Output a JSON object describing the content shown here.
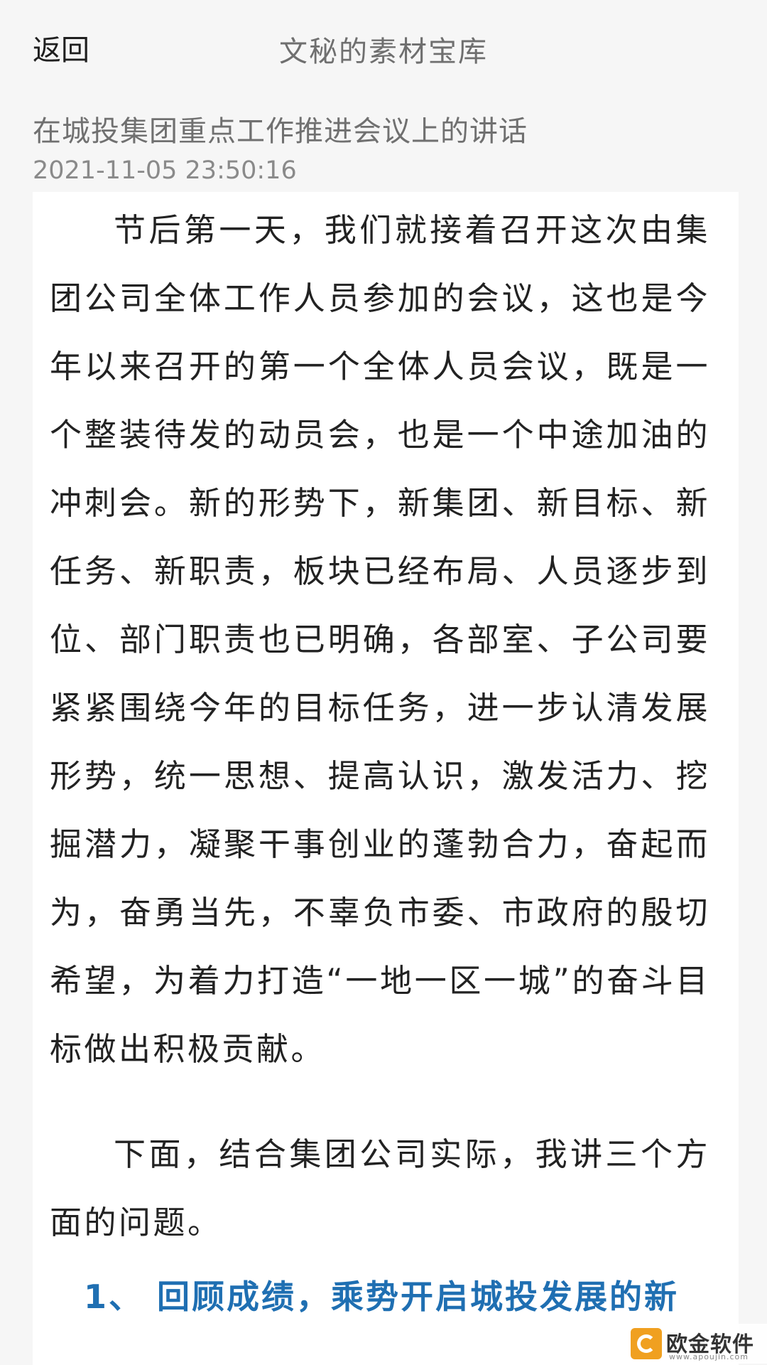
{
  "header": {
    "back_label": "返回",
    "app_title": "文秘的素材宝库"
  },
  "article": {
    "title": "在城投集团重点工作推进会议上的讲话",
    "date": "2021-11-05 23:50:16",
    "paragraphs": [
      "节后第一天，我们就接着召开这次由集团公司全体工作人员参加的会议，这也是今年以来召开的第一个全体人员会议，既是一个整装待发的动员会，也是一个中途加油的冲刺会。新的形势下，新集团、新目标、新任务、新职责，板块已经布局、人员逐步到位、部门职责也已明确，各部室、子公司要紧紧围绕今年的目标任务，进一步认清发展形势，统一思想、提高认识，激发活力、挖掘潜力，凝聚干事创业的蓬勃合力，奋起而为，奋勇当先，不辜负市委、市政府的殷切希望，为着力打造“一地一区一城”的奋斗目标做出积极贡献。",
      "下面，结合集团公司实际，我讲三个方面的问题。"
    ],
    "section_heading": "1、 回顾成绩，乘势开启城投发展的新"
  },
  "watermark": {
    "text": "欧金软件园",
    "sub": "www.apoujin.com",
    "accent": "#f0a020"
  },
  "colors": {
    "background": "#f6f6f6",
    "card": "#ffffff",
    "heading_blue": "#1f6fb2"
  }
}
